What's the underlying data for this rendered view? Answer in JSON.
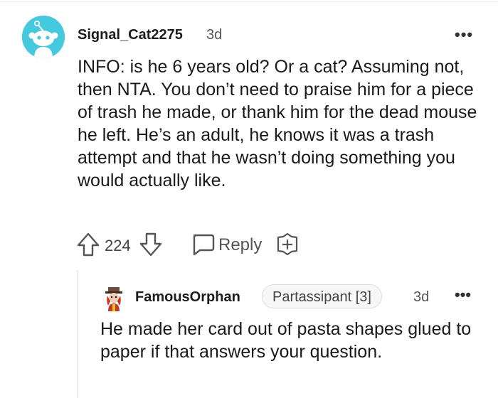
{
  "comment": {
    "author": "Signal_Cat2275",
    "time": "3d",
    "more": "•••",
    "body": "INFO: is he 6 years old? Or a cat? Assuming not, then NTA. You don’t need to praise him for a piece of trash he made, or thank him for the dead mouse he left. He’s an adult, he knows it was a trash attempt and that he wasn’t doing something you would actually like.",
    "votes": "224",
    "reply_label": "Reply",
    "avatar_color": "#45c9df"
  },
  "reply": {
    "author": "FamousOrphan",
    "flair": "Partassipant [3]",
    "time": "3d",
    "more": "•••",
    "body": "He made her card out of pasta shapes glued to paper if that answers your question."
  }
}
